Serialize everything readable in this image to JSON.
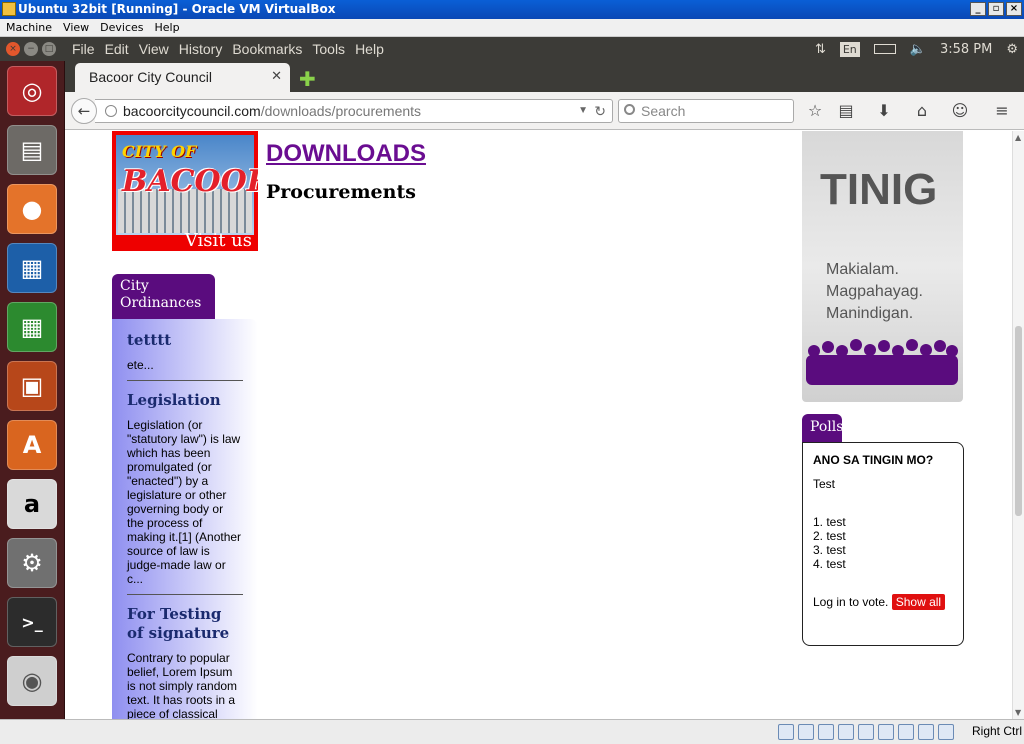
{
  "vbox": {
    "title": "Ubuntu 32bit [Running] - Oracle VM VirtualBox",
    "menu": [
      "Machine",
      "View",
      "Devices",
      "Help"
    ],
    "host_key": "Right Ctrl"
  },
  "ubuntu_panel": {
    "menu": [
      "File",
      "Edit",
      "View",
      "History",
      "Bookmarks",
      "Tools",
      "Help"
    ],
    "keyboard": "En",
    "clock": "3:58 PM"
  },
  "launcher": {
    "apps": [
      "ubuntu-dash",
      "files",
      "firefox",
      "writer",
      "calc",
      "impress",
      "software-center",
      "amazon",
      "system-settings",
      "terminal",
      "dvd"
    ]
  },
  "browser": {
    "tab_title": "Bacoor City Council",
    "url_host": "bacoorcitycouncil.com",
    "url_path": "/downloads/procurements",
    "search_placeholder": "Search"
  },
  "page": {
    "logo": {
      "line1": "CITY OF",
      "line2": "BACOOR",
      "visit": "Visit us"
    },
    "heading": "DOWNLOADS",
    "subheading": "Procurements",
    "ordinances": {
      "tab": "City Ordinances",
      "items": [
        {
          "title": "tetttt",
          "text": "ete..."
        },
        {
          "title": "Legislation",
          "text": "Legislation (or \"statutory law\") is law which has been promulgated (or \"enacted\") by a legislature or other governing body or the process of making it.[1] (Another source of law is judge-made law or c..."
        },
        {
          "title": "For Testing of signature",
          "text": "Contrary to popular belief, Lorem Ipsum is not simply random text. It has roots in a piece of classical"
        }
      ]
    },
    "banner": {
      "title": "TINIG",
      "tagline": [
        "Makialam.",
        "Magpahayag.",
        "Manindigan."
      ],
      "accent": "#5a0c7e"
    },
    "polls": {
      "tab": "Polls",
      "question": "ANO SA TINGIN MO?",
      "description": "Test",
      "options": [
        "1. test",
        "2. test",
        "3. test",
        "4. test"
      ],
      "login_text": "Log in to vote.",
      "show_all": "Show all"
    }
  }
}
